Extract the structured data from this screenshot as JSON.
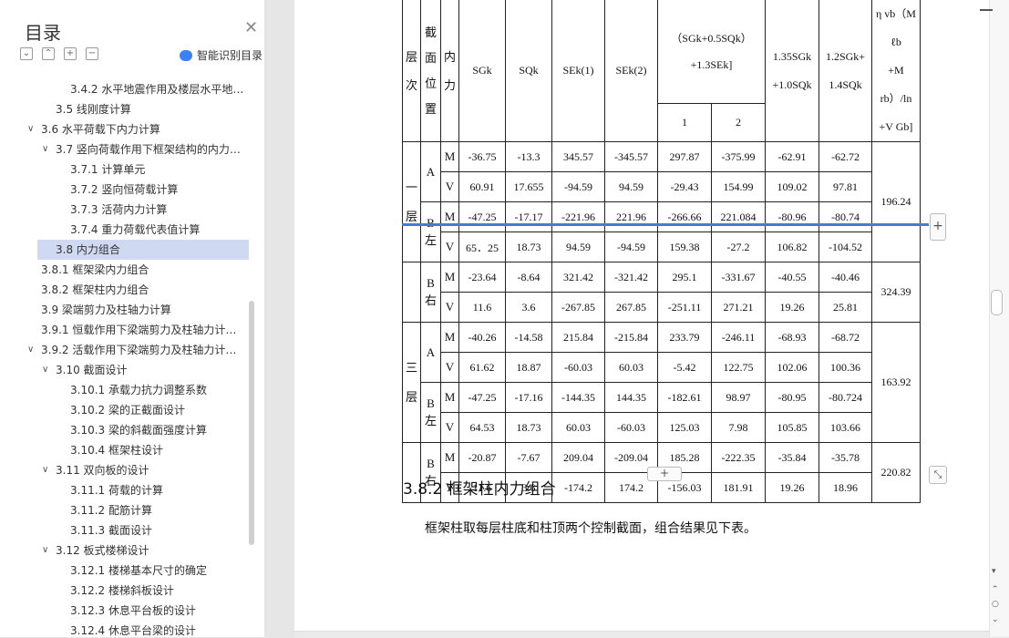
{
  "sidebar": {
    "title": "目录",
    "smart_label": "智能识别目录",
    "toc": [
      {
        "label": "3.4.2 水平地震作用及楼层水平地…",
        "indent": 3,
        "chev": ""
      },
      {
        "label": "3.5  线刚度计算",
        "indent": 2,
        "chev": ""
      },
      {
        "label": "3.6  水平荷载下内力计算",
        "indent": 1,
        "chev": "v"
      },
      {
        "label": "3.7  竖向荷载作用下框架结构的内力…",
        "indent": 2,
        "chev": "v"
      },
      {
        "label": "3.7.1 计算单元",
        "indent": 3,
        "chev": ""
      },
      {
        "label": "3.7.2  竖向恒荷载计算",
        "indent": 3,
        "chev": ""
      },
      {
        "label": "3.7.3 活荷内力计算",
        "indent": 3,
        "chev": ""
      },
      {
        "label": "3.7.4 重力荷载代表值计算",
        "indent": 3,
        "chev": ""
      },
      {
        "label": "3.8  内力组合",
        "indent": 2,
        "chev": "",
        "selected": true
      },
      {
        "label": "3.8.1 框架梁内力组合",
        "indent": 0,
        "chev": ""
      },
      {
        "label": "3.8.2 框架柱内力组合",
        "indent": 0,
        "chev": ""
      },
      {
        "label": "3.9  梁端剪力及柱轴力计算",
        "indent": 0,
        "chev": ""
      },
      {
        "label": "3.9.1  恒载作用下梁端剪力及柱轴力计…",
        "indent": 0,
        "chev": ""
      },
      {
        "label": "3.9.2  活载作用下梁端剪力及柱轴力计…",
        "indent": 0,
        "chev": "v"
      },
      {
        "label": "3.10  截面设计",
        "indent": 2,
        "chev": "v"
      },
      {
        "label": "3.10.1  承载力抗力调整系数",
        "indent": 3,
        "chev": ""
      },
      {
        "label": "3.10.2  梁的正截面设计",
        "indent": 3,
        "chev": ""
      },
      {
        "label": "3.10.3 梁的斜截面强度计算",
        "indent": 3,
        "chev": ""
      },
      {
        "label": "3.10.4 框架柱设计",
        "indent": 3,
        "chev": ""
      },
      {
        "label": "3.11  双向板的设计",
        "indent": 2,
        "chev": "v"
      },
      {
        "label": "3.11.1 荷载的计算",
        "indent": 3,
        "chev": ""
      },
      {
        "label": "3.11.2 配筋计算",
        "indent": 3,
        "chev": ""
      },
      {
        "label": "3.11.3 截面设计",
        "indent": 3,
        "chev": ""
      },
      {
        "label": "3.12 板式楼梯设计",
        "indent": 2,
        "chev": "v"
      },
      {
        "label": "3.12.1 楼梯基本尺寸的确定",
        "indent": 3,
        "chev": ""
      },
      {
        "label": "3.12.2 楼梯斜板设计",
        "indent": 3,
        "chev": ""
      },
      {
        "label": "3.12.3 休息平台板的设计",
        "indent": 3,
        "chev": ""
      },
      {
        "label": "3.12.4 休息平台梁的设计",
        "indent": 3,
        "chev": ""
      }
    ]
  },
  "table": {
    "header": {
      "ceng": "层\n次",
      "jiemian": "截\n面\n位\n置",
      "neili": "内\n力",
      "sgk": "SGk",
      "sqk": "SQk",
      "sek1": "SEk(1)",
      "sek2": "SEk(2)",
      "combo_top": "",
      "combo_formula": "（SGk+0.5SQk）",
      "combo_formula2": "+1.3SEk]",
      "combo_1": "1",
      "combo_2": "2",
      "c135": "1.35SGk\n+1.0SQk",
      "c12": "1.2SGk+\n1.4SQk",
      "vlast": "η vb（M ℓb\n+M rb）/ln\n+V Gb]"
    },
    "groups": [
      {
        "floor": "一\n层",
        "sections": [
          {
            "pos": "A",
            "rows": [
              {
                "f": "M",
                "v": [
                  "-36.75",
                  "-13.3",
                  "345.57",
                  "-345.57",
                  "297.87",
                  "-375.99",
                  "-62.91",
                  "-62.72"
                ]
              },
              {
                "f": "V",
                "v": [
                  "60.91",
                  "17.655",
                  "-94.59",
                  "94.59",
                  "-29.43",
                  "154.99",
                  "109.02",
                  "97.81"
                ]
              }
            ]
          },
          {
            "pos": "B 左",
            "rows": [
              {
                "f": "M",
                "v": [
                  "-47.25",
                  "-17.17",
                  "-221.96",
                  "221.96",
                  "-266.66",
                  "221.084",
                  "-80.96",
                  "-80.74"
                ]
              },
              {
                "f": "V",
                "v": [
                  "65．25",
                  "18.73",
                  "94.59",
                  "-94.59",
                  "159.38",
                  "-27.2",
                  "106.82",
                  "-104.52"
                ]
              }
            ]
          }
        ],
        "last": "196.24"
      },
      {
        "floor": "",
        "sections": [
          {
            "pos": "B 右",
            "rows": [
              {
                "f": "M",
                "v": [
                  "-23.64",
                  "-8.64",
                  "321.42",
                  "-321.42",
                  "295.1",
                  "-331.67",
                  "-40.55",
                  "-40.46"
                ]
              },
              {
                "f": "V",
                "v": [
                  "11.6",
                  "3.6",
                  "-267.85",
                  "267.85",
                  "-251.11",
                  "271.21",
                  "19.26",
                  "25.81"
                ]
              }
            ]
          }
        ],
        "last": "324.39"
      },
      {
        "floor": "三\n层",
        "sections": [
          {
            "pos": "A",
            "rows": [
              {
                "f": "M",
                "v": [
                  "-40.26",
                  "-14.58",
                  "215.84",
                  "-215.84",
                  "233.79",
                  "-246.11",
                  "-68.93",
                  "-68.72"
                ]
              },
              {
                "f": "V",
                "v": [
                  "61.62",
                  "18.87",
                  "-60.03",
                  "60.03",
                  "-5.42",
                  "122.75",
                  "102.06",
                  "100.36"
                ]
              }
            ]
          },
          {
            "pos": "B 左",
            "rows": [
              {
                "f": "M",
                "v": [
                  "-47.25",
                  "-17.16",
                  "-144.35",
                  "144.35",
                  "-182.61",
                  "98.97",
                  "-80.95",
                  "-80.724"
                ]
              },
              {
                "f": "V",
                "v": [
                  "64.53",
                  "18.73",
                  "60.03",
                  "-60.03",
                  "125.03",
                  "7.98",
                  "105.85",
                  "103.66"
                ]
              }
            ]
          }
        ],
        "last": "163.92"
      },
      {
        "floor": "",
        "sections": [
          {
            "pos": "B 右",
            "rows": [
              {
                "f": "M",
                "v": [
                  "-20.87",
                  "-7.67",
                  "209.04",
                  "-209.04",
                  "185.28",
                  "-222.35",
                  "-35.84",
                  "-35.78"
                ]
              },
              {
                "f": "V",
                "v": [
                  "11.6",
                  "3.6",
                  "-174.2",
                  "174.2",
                  "-156.03",
                  "181.91",
                  "19.26",
                  "18.96"
                ]
              }
            ]
          }
        ],
        "last": "220.82"
      }
    ]
  },
  "doc": {
    "section_heading": "3.8.2 框架柱内力组合",
    "section_body": "框架柱取每层柱底和柱顶两个控制截面，组合结果见下表。",
    "plus": "+"
  },
  "colors": {
    "accent": "#3f7fd1",
    "selected": "#cfd9f2"
  }
}
